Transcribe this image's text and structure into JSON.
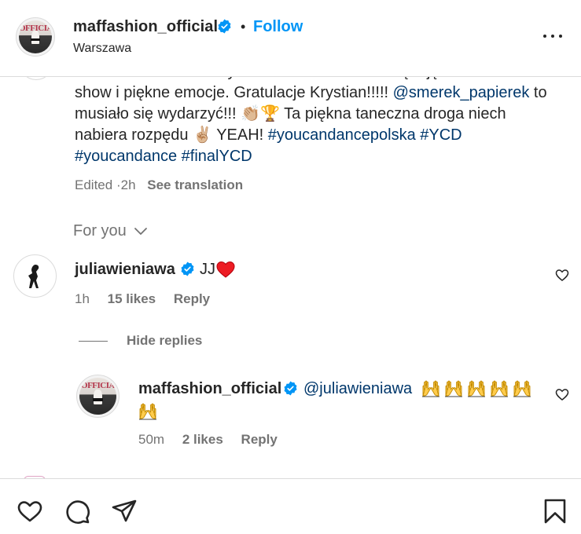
{
  "header": {
    "username": "maffashion_official",
    "separator": "•",
    "follow_label": "Follow",
    "location": "Warszawa",
    "avatar_logo_text": "OFFICIA"
  },
  "caption": {
    "line1": "Serce i brawa dla wszystkich uczestników!! Dziękuję za niesamowite",
    "line2": "show i piękne emocje. Gratulacje Krystian!!!!! ",
    "mention": "@smerek_papierek",
    "line2_end": " to",
    "line3": "musiało się wydarzyć!!! 👏🏼🏆 Ta piękna taneczna droga niech",
    "line4_start": "nabiera rozpędu ✌🏼 YEAH! ",
    "tag1": "#youcandancepolska",
    "tag2": "#YCD",
    "tag3": "#youcandance",
    "tag4": "#finalYCD",
    "edited": "Edited",
    "dot": "·",
    "time": "2h",
    "see_translation": "See translation"
  },
  "for_you": {
    "label": "For you"
  },
  "comments": [
    {
      "username": "juliawieniawa",
      "text": "JJ",
      "emoji": "heart",
      "time": "1h",
      "likes": "15 likes",
      "reply_label": "Reply"
    }
  ],
  "hide_replies": {
    "label": "Hide replies"
  },
  "reply": {
    "username": "maffashion_official",
    "mention": "@juliawieniawa",
    "emoji": "raising-hands",
    "emoji_count": 6,
    "time": "50m",
    "likes": "2 likes",
    "reply_label": "Reply"
  },
  "colors": {
    "link_blue": "#0095f6",
    "mention_blue": "#00376b",
    "secondary_text": "#737373",
    "primary_text": "#262626",
    "heart_red": "#ed1c24",
    "verified_blue": "#0095f6"
  },
  "action_icons": [
    "heart-icon",
    "comment-icon",
    "share-icon",
    "bookmark-icon"
  ]
}
